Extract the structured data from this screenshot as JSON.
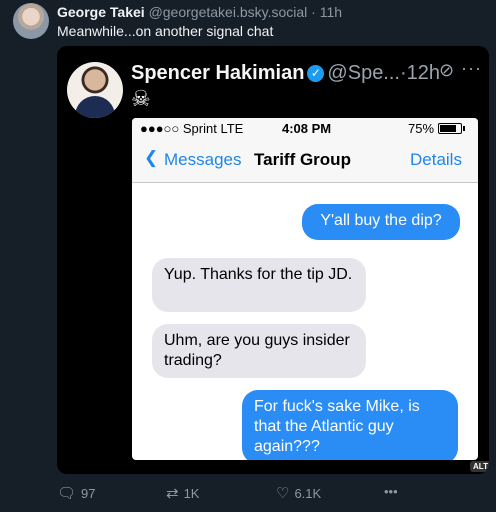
{
  "post": {
    "author_name": "George Takei",
    "author_handle": "@georgetakei.bsky.social",
    "separator": "·",
    "time": "11h",
    "text": "Meanwhile...on another signal chat"
  },
  "embed": {
    "author_name": "Spencer Hakimian",
    "author_handle": "@Spe...",
    "separator": "·",
    "time": "12h",
    "bio_emoji": "☠",
    "alt_badge": "ALT",
    "phone": {
      "status_left": "●●●○○ Sprint  LTE",
      "status_time": "4:08 PM",
      "status_battery": "75%",
      "nav_back": "Messages",
      "nav_title": "Tariff Group",
      "nav_details": "Details",
      "messages": [
        {
          "text": "Y'all buy the dip?",
          "direction": "outgoing"
        },
        {
          "text": "Yup. Thanks for the tip JD.",
          "direction": "incoming"
        },
        {
          "text": "Uhm, are you guys insider trading?",
          "direction": "incoming"
        },
        {
          "text": "For fuck's sake Mike, is that the Atlantic guy again???",
          "direction": "outgoing"
        }
      ]
    }
  },
  "actions": {
    "replies": "97",
    "reposts": "1K",
    "likes": "6.1K",
    "more": "•••"
  },
  "icons": {
    "reply": "speech-bubble-icon",
    "repost": "repost-arrows-icon",
    "like": "heart-icon",
    "verified": "checkmark-badge-icon",
    "mute": "slashed-circle-icon"
  },
  "colors": {
    "background": "#161e27",
    "outgoing_bubble": "#2a8cf5",
    "incoming_bubble": "#e6e5eb",
    "ios_blue": "#1f86ea",
    "verified": "#1d9bf0"
  }
}
